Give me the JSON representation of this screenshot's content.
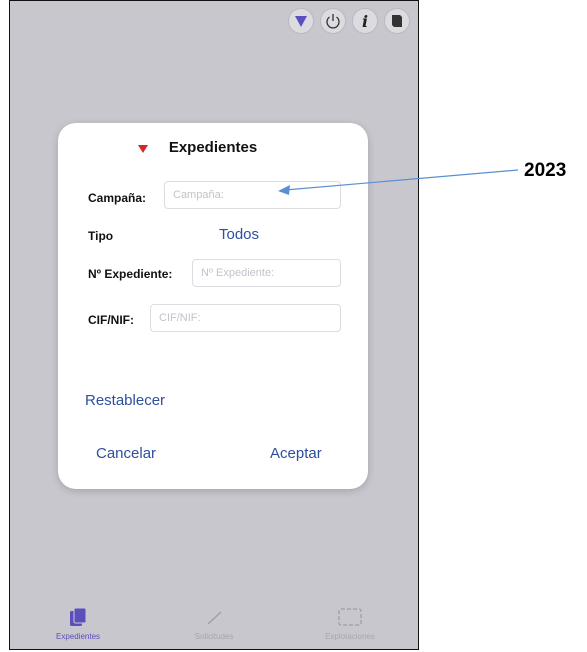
{
  "dialog": {
    "title": "Expedientes",
    "campana_label": "Campaña:",
    "campana_placeholder": "Campaña:",
    "tipo_label": "Tipo",
    "tipo_value": "Todos",
    "expediente_label": "Nº Expediente:",
    "expediente_placeholder": "Nº Expediente:",
    "cif_label": "CIF/NIF:",
    "cif_placeholder": "CIF/NIF:",
    "reset_label": "Restablecer",
    "cancel_label": "Cancelar",
    "accept_label": "Aceptar"
  },
  "tabs": [
    {
      "label": "Expedientes"
    },
    {
      "label": "Solicitudes"
    },
    {
      "label": "Explotaciones"
    }
  ],
  "annotation": {
    "text": "2023"
  },
  "colors": {
    "accent": "#5a4fbd",
    "link": "#2c4f9e",
    "marker": "#d62626",
    "arrow": "#5a8fd0",
    "background": "#c9c7ce"
  },
  "icons": [
    "filter-icon",
    "power-icon",
    "info-icon",
    "book-icon",
    "documents-icon",
    "pencil-icon",
    "dashed-rect-icon"
  ]
}
